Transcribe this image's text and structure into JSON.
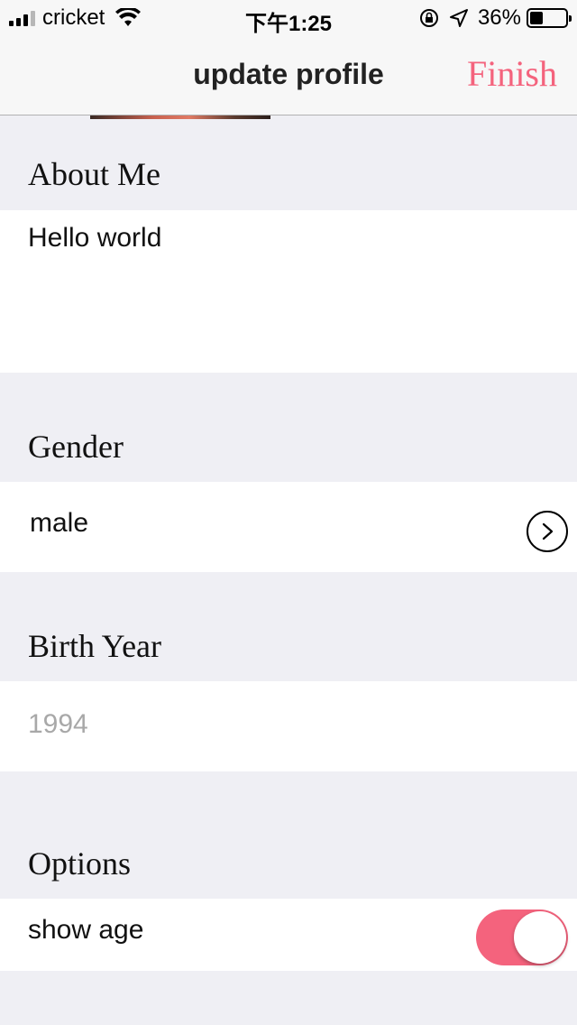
{
  "status_bar": {
    "carrier": "cricket",
    "time": "下午1:25",
    "battery_percent": "36%",
    "battery_level": 0.36
  },
  "nav": {
    "title": "update profile",
    "finish_label": "Finish"
  },
  "sections": {
    "about": {
      "header": "About Me",
      "value": "Hello world"
    },
    "gender": {
      "header": "Gender",
      "value": "male"
    },
    "birth_year": {
      "header": "Birth Year",
      "placeholder": "1994"
    },
    "options": {
      "header": "Options",
      "show_age_label": "show age",
      "show_age_on": true
    }
  },
  "colors": {
    "accent": "#f4637d",
    "background": "#efeff4"
  }
}
